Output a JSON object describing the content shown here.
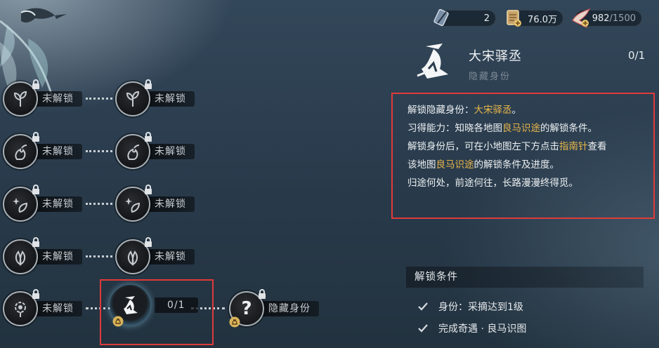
{
  "resources": {
    "item1": {
      "icon": "quill-ticket-icon",
      "value": "2"
    },
    "item2": {
      "icon": "scroll-currency-icon",
      "value": "76.0万"
    },
    "item3": {
      "icon": "crane-bird-icon",
      "value": "982",
      "max": "/1500"
    }
  },
  "grid": {
    "locked_label": "未解锁",
    "selected_progress": "0/1",
    "hidden_label": "隐藏身份"
  },
  "detail": {
    "title": "大宋驿丞",
    "subtitle": "隐藏身份",
    "count": "0/1",
    "lines": {
      "l1_a": "解锁隐藏身份：",
      "l1_hl": "大宋驿丞",
      "l1_b": "。",
      "l2_a": "习得能力：知晓各地图",
      "l2_hl": "良马识途",
      "l2_b": "的解锁条件。",
      "l3_a": "解锁身份后，可在小地图左下方点击",
      "l3_hl": "指南针",
      "l3_b": "查看",
      "l4_a": "该地图",
      "l4_hl": "良马识途",
      "l4_b": "的解锁条件及进度。",
      "l5": "归途何处，前途何往，长路漫漫终得觅。"
    }
  },
  "conditions": {
    "header": "解锁条件",
    "items": [
      "身份：采摘达到1级",
      "完成奇遇 · 良马识图"
    ]
  },
  "colors": {
    "highlight": "#e8b64a",
    "redbox": "#e03a3a"
  }
}
